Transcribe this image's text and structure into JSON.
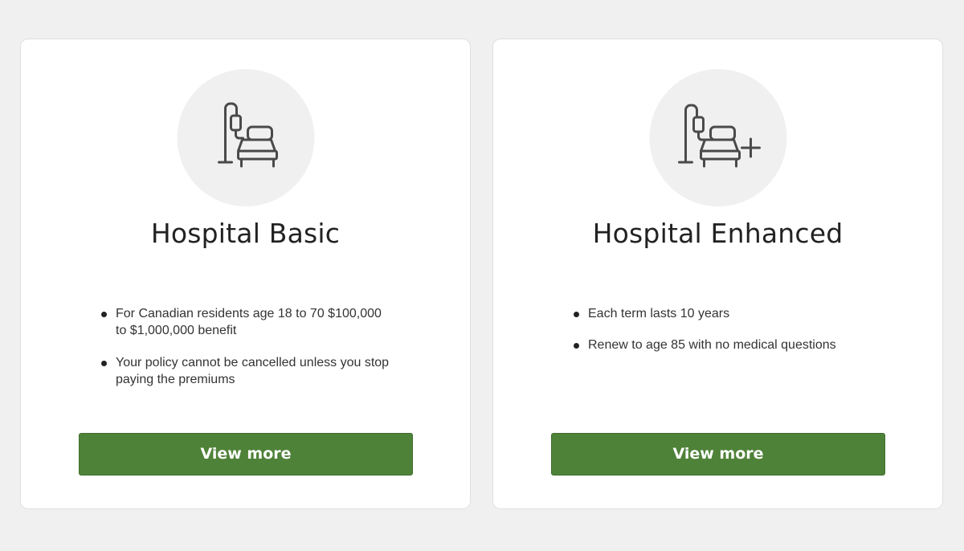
{
  "cards": [
    {
      "title": "Hospital Basic",
      "icon": "hospital-bed-iv-icon",
      "features": [
        "For Canadian residents age 18 to 70 $100,000 to $1,000,000 benefit",
        "Your policy cannot be cancelled unless you stop paying the premiums"
      ],
      "button_label": "View more"
    },
    {
      "title": "Hospital Enhanced",
      "icon": "hospital-bed-iv-plus-icon",
      "features": [
        "Each term lasts 10 years",
        "Renew to age 85 with no medical questions"
      ],
      "button_label": "View more"
    }
  ],
  "colors": {
    "page_background": "#f0f0f0",
    "card_background": "#ffffff",
    "button_background": "#4f8239",
    "icon_stroke": "#4a4a4a"
  }
}
